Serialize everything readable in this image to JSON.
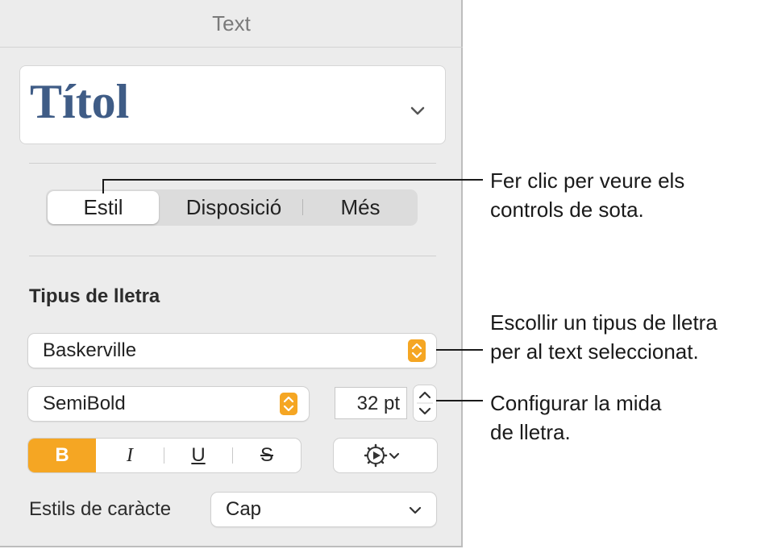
{
  "panel": {
    "header_title": "Text",
    "paragraph_style": "Títol",
    "tabs": [
      {
        "label": "Estil",
        "active": true
      },
      {
        "label": "Disposició",
        "active": false
      },
      {
        "label": "Més",
        "active": false
      }
    ],
    "font_section_title": "Tipus de lletra",
    "font_family": "Baskerville",
    "font_weight": "SemiBold",
    "font_size": "32 pt",
    "format_buttons": {
      "bold": "B",
      "italic": "I",
      "underline": "U",
      "strike": "S"
    },
    "char_styles_label": "Estils de caràcte",
    "char_style_value": "Cap",
    "accent_color": "#f5a623",
    "title_color": "#3f5c86"
  },
  "callouts": {
    "tabs_line1": "Fer clic per veure els",
    "tabs_line2": "controls de sota.",
    "font_line1": "Escollir un tipus de lletra",
    "font_line2": "per al text seleccionat.",
    "size_line1": "Configurar la mida",
    "size_line2": "de lletra."
  }
}
